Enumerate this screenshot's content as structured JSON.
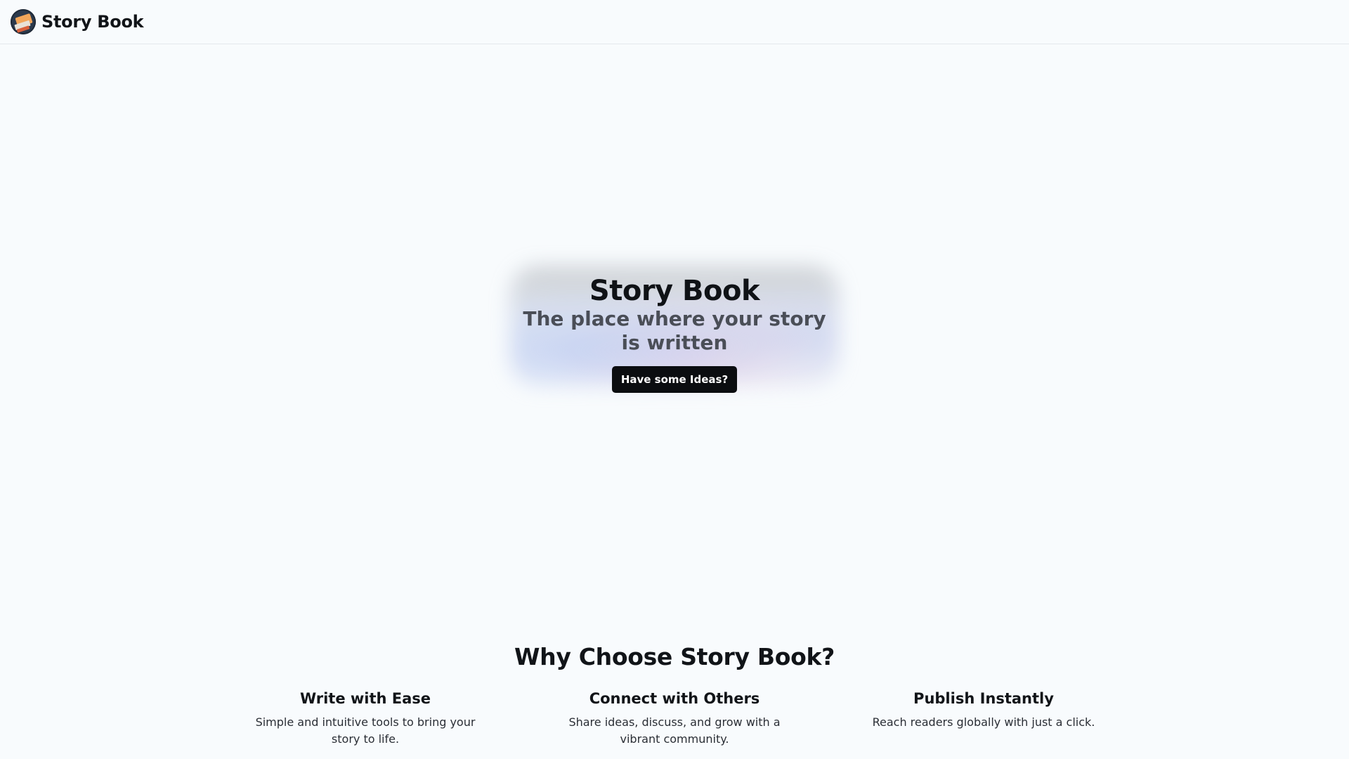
{
  "header": {
    "brand": "Story Book",
    "logo_icon": "book-stack-icon"
  },
  "hero": {
    "title": "Story Book",
    "subtitle": "The place where your story is written",
    "cta_label": "Have some Ideas?"
  },
  "features_section": {
    "title": "Why Choose Story Book?",
    "items": [
      {
        "title": "Write with Ease",
        "description": "Simple and intuitive tools to bring your story to life."
      },
      {
        "title": "Connect with Others",
        "description": "Share ideas, discuss, and grow with a vibrant community."
      },
      {
        "title": "Publish Instantly",
        "description": "Reach readers globally with just a click."
      }
    ]
  },
  "colors": {
    "background": "#f8fbfd",
    "primary_button": "#0b0d10",
    "subtitle_text": "#4a4e57"
  }
}
